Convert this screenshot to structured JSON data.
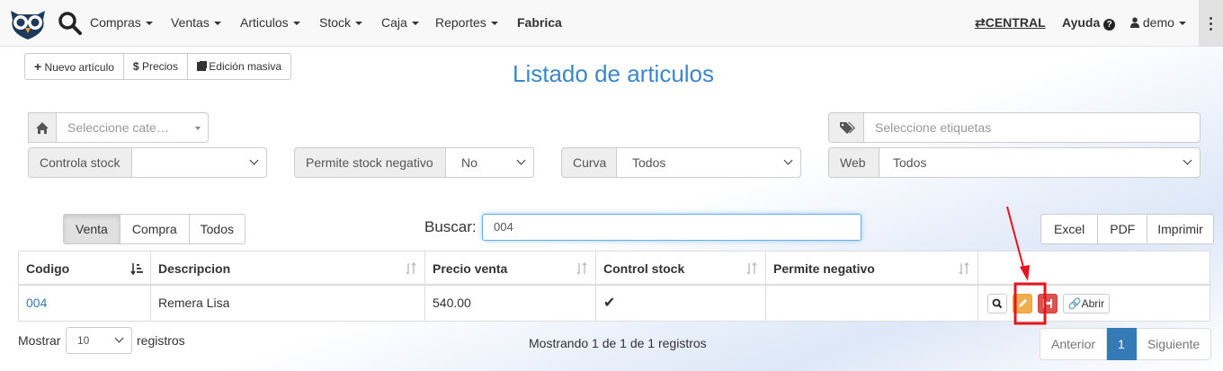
{
  "navbar": {
    "menus": [
      {
        "label": "Compras",
        "caret": true
      },
      {
        "label": "Ventas",
        "caret": true
      },
      {
        "label": "Articulos",
        "caret": true
      },
      {
        "label": "Stock",
        "caret": true
      },
      {
        "label": "Caja",
        "caret": true
      },
      {
        "label": "Reportes",
        "caret": true
      },
      {
        "label": "Fabrica",
        "caret": false
      }
    ],
    "branch": "CENTRAL",
    "help": "Ayuda",
    "user": "demo"
  },
  "toolbar": {
    "new_item": "Nuevo artículo",
    "prices": "Precios",
    "mass_edit": "Edición masiva"
  },
  "page_title": "Listado de articulos",
  "filters": {
    "category_placeholder": "Seleccione cate…",
    "tags_placeholder": "Seleccione etiquetas",
    "controla_stock_label": "Controla stock",
    "controla_stock_value": "",
    "permite_stock_label": "Permite stock negativo",
    "permite_stock_value": "No",
    "curva_label": "Curva",
    "curva_value": "Todos",
    "web_label": "Web",
    "web_value": "Todos"
  },
  "price_tabs": [
    "Venta",
    "Compra",
    "Todos"
  ],
  "search": {
    "label": "Buscar:",
    "value": "004"
  },
  "export_buttons": [
    "Excel",
    "PDF",
    "Imprimir"
  ],
  "table": {
    "columns": [
      "Codigo",
      "Descripcion",
      "Precio venta",
      "Control stock",
      "Permite negativo",
      ""
    ],
    "rows": [
      {
        "codigo": "004",
        "descripcion": "Remera Lisa",
        "precio": "540.00",
        "control_stock": "✔",
        "permite_negativo": "",
        "open_label": "Abrir"
      }
    ]
  },
  "footer": {
    "show_label": "Mostrar",
    "page_size": "10",
    "records_label": "registros",
    "info": "Mostrando 1 de 1 de 1 registros",
    "prev": "Anterior",
    "page": "1",
    "next": "Siguiente"
  },
  "colors": {
    "accent": "#337ab7",
    "edit": "#f0ad4e",
    "delete": "#d9534f",
    "annotation": "#e8141c"
  }
}
